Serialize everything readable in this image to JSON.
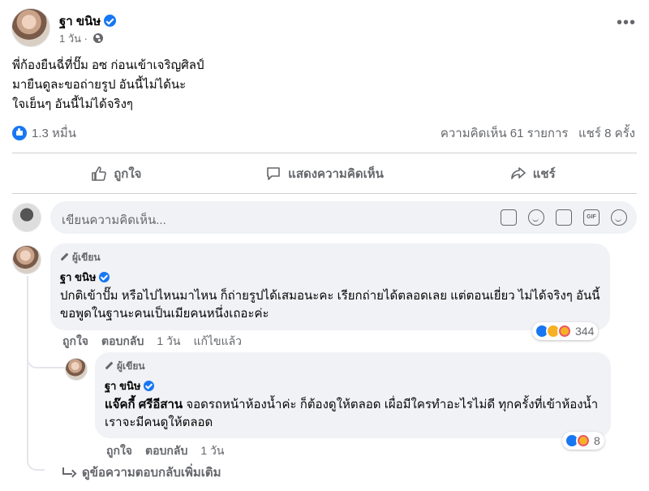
{
  "post": {
    "author": "ฐา ขนิษ",
    "time": "1 วัน",
    "privacy_icon": "globe-icon",
    "lines": [
      "พี่ก้องยืนฉี่ที่ปั๊ม อซ ก่อนเข้าเจริญศิลป์",
      "มายืนดูละขอถ่ายรูป อันนี้ไม่ได้นะ",
      "ใจเย็นๆ อันนี้ไม่ได้จริงๆ"
    ],
    "reaction_count": "1.3 หมื่น",
    "comments_count": "ความคิดเห็น 61 รายการ",
    "shares_count": "แชร์ 8 ครั้ง"
  },
  "actions": {
    "like": "ถูกใจ",
    "comment": "แสดงความคิดเห็น",
    "share": "แชร์"
  },
  "composer": {
    "placeholder": "เขียนความคิดเห็น...",
    "icons": [
      "sticker-icon",
      "emoji-icon",
      "camera-icon",
      "gif-icon",
      "sticker-face-icon"
    ],
    "gif_label": "GIF"
  },
  "comments": [
    {
      "author_tag": "ผู้เขียน",
      "author": "ฐา ขนิษ",
      "text": "ปกติเข้าปั๊ม หรือไปไหนมาไหน ก็ถ่ายรูปได้เสมอนะคะ เรียกถ่ายได้ตลอดเลย แต่ตอนเยี่ยว ไม่ได้จริงๆ อันนี้ขอพูดในฐานะคนเป็นเมียคนหนึ่งเถอะค่ะ",
      "like": "ถูกใจ",
      "reply": "ตอบกลับ",
      "time": "1 วัน",
      "edited": "แก้ไขแล้ว",
      "reactions": "344"
    },
    {
      "author_tag": "ผู้เขียน",
      "author": "ฐา ขนิษ",
      "mention": "แจ๊คกี้ ศรีอีสาน",
      "text": " จอดรถหน้าห้องน้ำค่ะ ก็ต้องดูให้ตลอด เผื่อมีใครทำอะไรไม่ดี ทุกครั้งที่เข้าห้องน้ำ เราจะมีคนดูให้ตลอด",
      "like": "ถูกใจ",
      "reply": "ตอบกลับ",
      "time": "1 วัน",
      "reactions": "8"
    }
  ],
  "more_replies": "ดูข้อความตอบกลับเพิ่มเติม",
  "colors": {
    "accent": "#1877f2",
    "bubble": "#f0f2f5",
    "secondary_text": "#65676b"
  }
}
